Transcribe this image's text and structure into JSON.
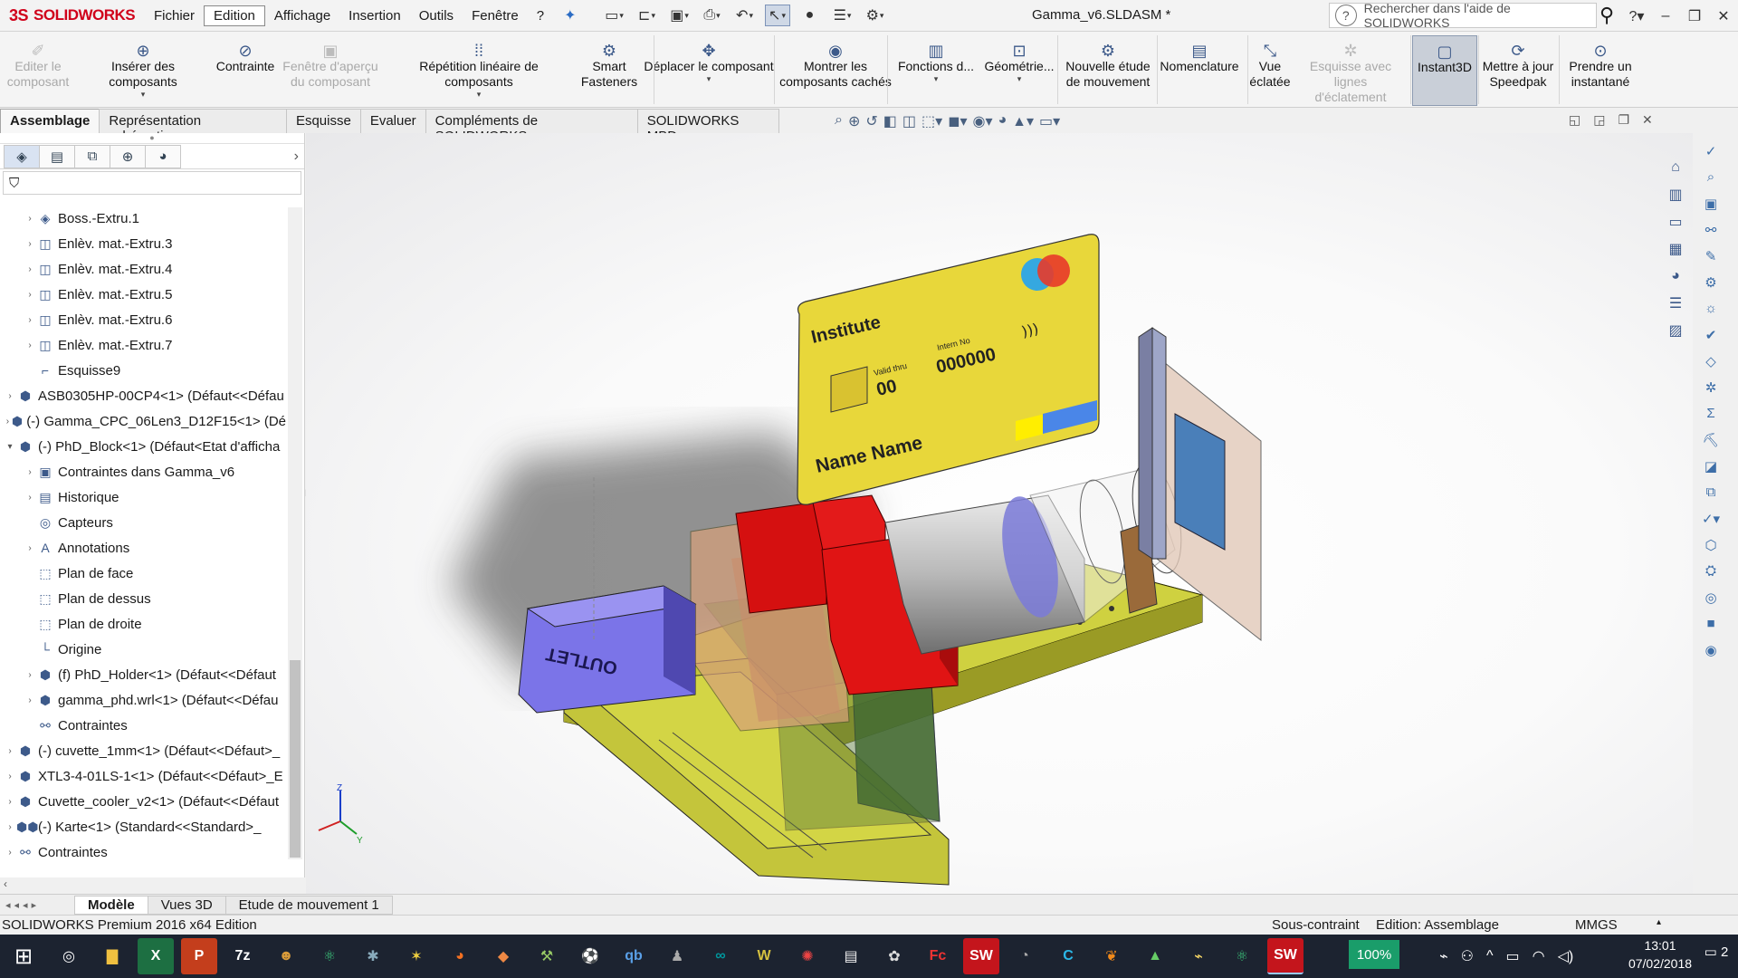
{
  "titlebar": {
    "logo_prefix": "3S",
    "logo_text": "SOLIDWORKS",
    "menu": [
      "Fichier",
      "Edition",
      "Affichage",
      "Insertion",
      "Outils",
      "Fenêtre",
      "?"
    ],
    "active_menu": "Edition",
    "document_title": "Gamma_v6.SLDASM *",
    "help_search_placeholder": "Rechercher dans l'aide de SOLIDWORKS"
  },
  "ribbon": {
    "buttons": [
      {
        "label1": "Editer le",
        "label2": "composant",
        "icon": "edit-component-icon",
        "disabled": true
      },
      {
        "label1": "Insérer des composants",
        "label2": "",
        "icon": "insert-components-icon",
        "disabled": false
      },
      {
        "label1": "Contrainte",
        "label2": "",
        "icon": "mate-icon",
        "disabled": false
      },
      {
        "label1": "Fenêtre d'aperçu",
        "label2": "du composant",
        "icon": "component-preview-icon",
        "disabled": true
      },
      {
        "label1": "Répétition linéaire de composants",
        "label2": "",
        "icon": "linear-pattern-icon",
        "disabled": false
      },
      {
        "label1": "Smart",
        "label2": "Fasteners",
        "icon": "smart-fasteners-icon",
        "disabled": false
      },
      {
        "label1": "Déplacer le composant",
        "label2": "",
        "icon": "move-component-icon",
        "disabled": false
      },
      {
        "label1": "Montrer les",
        "label2": "composants cachés",
        "icon": "show-hidden-icon",
        "disabled": false
      },
      {
        "label1": "Fonctions d...",
        "label2": "",
        "icon": "features-icon",
        "disabled": false
      },
      {
        "label1": "Géométrie...",
        "label2": "",
        "icon": "geometry-icon",
        "disabled": false
      },
      {
        "label1": "Nouvelle étude",
        "label2": "de mouvement",
        "icon": "motion-study-icon",
        "disabled": false
      },
      {
        "label1": "Nomenclature",
        "label2": "",
        "icon": "bom-icon",
        "disabled": false
      },
      {
        "label1": "Vue",
        "label2": "éclatée",
        "icon": "exploded-view-icon",
        "disabled": false
      },
      {
        "label1": "Esquisse avec lignes",
        "label2": "d'éclatement",
        "icon": "explode-line-icon",
        "disabled": true
      },
      {
        "label1": "Instant3D",
        "label2": "",
        "icon": "instant3d-icon",
        "disabled": false
      },
      {
        "label1": "Mettre à jour",
        "label2": "Speedpak",
        "icon": "speedpak-icon",
        "disabled": false
      },
      {
        "label1": "Prendre un",
        "label2": "instantané",
        "icon": "snapshot-icon",
        "disabled": false
      }
    ],
    "pressed": "Instant3D"
  },
  "tabs": [
    "Assemblage",
    "Représentation schématique",
    "Esquisse",
    "Evaluer",
    "Compléments de SOLIDWORKS",
    "SOLIDWORKS MBD"
  ],
  "active_tab": "Assemblage",
  "tree": [
    {
      "label": "Boss.-Extru.1",
      "indent": 1,
      "expand": true,
      "icon": "feature-icon"
    },
    {
      "label": "Enlèv. mat.-Extru.3",
      "indent": 1,
      "expand": true,
      "icon": "cut-icon"
    },
    {
      "label": "Enlèv. mat.-Extru.4",
      "indent": 1,
      "expand": true,
      "icon": "cut-icon"
    },
    {
      "label": "Enlèv. mat.-Extru.5",
      "indent": 1,
      "expand": true,
      "icon": "cut-icon"
    },
    {
      "label": "Enlèv. mat.-Extru.6",
      "indent": 1,
      "expand": true,
      "icon": "cut-icon"
    },
    {
      "label": "Enlèv. mat.-Extru.7",
      "indent": 1,
      "expand": true,
      "icon": "cut-icon"
    },
    {
      "label": "Esquisse9",
      "indent": 1,
      "expand": false,
      "icon": "sketch-icon"
    },
    {
      "label": "ASB0305HP-00CP4<1> (Défaut<<Défau",
      "indent": 0,
      "expand": true,
      "icon": "part-icon"
    },
    {
      "label": "(-) Gamma_CPC_06Len3_D12F15<1> (Dé",
      "indent": 0,
      "expand": true,
      "icon": "part-icon"
    },
    {
      "label": "(-) PhD_Block<1> (Défaut<Etat d'afficha",
      "indent": 0,
      "expand": true,
      "open": true,
      "icon": "part-icon"
    },
    {
      "label": "Contraintes dans Gamma_v6",
      "indent": 1,
      "expand": true,
      "icon": "mates-folder-icon"
    },
    {
      "label": "Historique",
      "indent": 1,
      "expand": true,
      "icon": "history-icon"
    },
    {
      "label": "Capteurs",
      "indent": 1,
      "expand": false,
      "icon": "sensor-icon"
    },
    {
      "label": "Annotations",
      "indent": 1,
      "expand": true,
      "icon": "annotation-icon"
    },
    {
      "label": "Plan de face",
      "indent": 1,
      "expand": false,
      "icon": "plane-icon"
    },
    {
      "label": "Plan de dessus",
      "indent": 1,
      "expand": false,
      "icon": "plane-icon"
    },
    {
      "label": "Plan de droite",
      "indent": 1,
      "expand": false,
      "icon": "plane-icon"
    },
    {
      "label": "Origine",
      "indent": 1,
      "expand": false,
      "icon": "origin-icon"
    },
    {
      "label": "(f) PhD_Holder<1> (Défaut<<Défaut",
      "indent": 1,
      "expand": true,
      "icon": "part-icon"
    },
    {
      "label": "gamma_phd.wrl<1> (Défaut<<Défau",
      "indent": 1,
      "expand": true,
      "icon": "part-icon"
    },
    {
      "label": "Contraintes",
      "indent": 1,
      "expand": false,
      "icon": "mates-icon"
    },
    {
      "label": "(-) cuvette_1mm<1> (Défaut<<Défaut>_",
      "indent": 0,
      "expand": true,
      "icon": "part-icon"
    },
    {
      "label": "XTL3-4-01LS-1<1> (Défaut<<Défaut>_E",
      "indent": 0,
      "expand": true,
      "icon": "part-icon"
    },
    {
      "label": "Cuvette_cooler_v2<1> (Défaut<<Défaut",
      "indent": 0,
      "expand": true,
      "icon": "part-icon"
    },
    {
      "label": "(-) Karte<1> (Standard<<Standard>_",
      "indent": 0,
      "expand": true,
      "icon": "subassembly-icon"
    },
    {
      "label": "Contraintes",
      "indent": 0,
      "expand": true,
      "icon": "mates-icon"
    }
  ],
  "viewport": {
    "card": {
      "institute": "Institute",
      "valid_label": "Valid thru",
      "valid_value": "00",
      "id_label": "Intern No",
      "id_value": "000000",
      "name": "Name Name"
    },
    "outlet_label": "OUTLET",
    "triad": {
      "z": "Z",
      "y": "Y"
    }
  },
  "bottom_tabs": [
    "Modèle",
    "Vues 3D",
    "Etude de mouvement 1"
  ],
  "active_bottom_tab": "Modèle",
  "status": {
    "product": "SOLIDWORKS Premium 2016 x64 Edition",
    "mate_state": "Sous-contraint",
    "mode": "Edition: Assemblage",
    "units": "MMGS"
  },
  "taskbar": {
    "zoom": "100%",
    "time": "13:01",
    "date": "07/02/2018",
    "notifications": "2"
  },
  "colors": {
    "brand": "#d0021b",
    "accent": "#1a9d6a",
    "card_yellow": "#e8d73a",
    "base_olive": "#c2c43a",
    "red_block": "#e01414",
    "outlet_purple": "#7b74e8"
  }
}
